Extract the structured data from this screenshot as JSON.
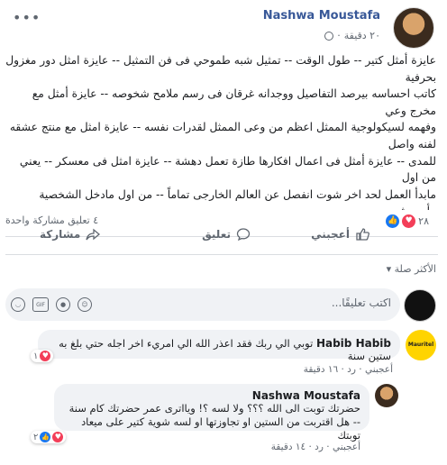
{
  "post": {
    "author": "Nashwa Moustafa",
    "time": "٢٠ دقيقة",
    "body": "عايزة أمثل كتير -- طول الوقت -- تمثيل شبه طموحي فى فن التمثيل -- عايزة امثل دور مغزول بحرفية\nكاتب احساسه بيرصد التفاصيل ووجدانه غرقان فى رسم ملامح شخوصه -- عايزة أمثل مع مخرج وعي\nوفهمه لسيكولوجية الممثل اعظم من وعى الممثل لقدرات نفسه -- عايزة امثل مع منتج عشقه لفنه واصل\nللمدى -- عايزة أمثل فى اعمال افكارها طازة تعمل دهشة -- عايزة امثل فى معسكر -- يعني من اول\nمابدأ العمل لحد اخر شوت انفصل عن العالم الخارجى تماماً -- من اول مادخل الشخصية مأرجعش\nنشوى غير مع كلمة فركش للعمل -- عايزة امثل مع كل المجانين المندوهين بنداهة الفن -- يارب حقق\nلى حلمى"
  },
  "stats": {
    "reactions": "٢٨",
    "counts": "٤ تعليق  مشاركة واحدة"
  },
  "actions": {
    "like": "أعجبني",
    "comment": "تعليق",
    "share": "مشاركة"
  },
  "sort_label": "الأكثر صلة ▾",
  "composer": {
    "placeholder": "اكتب تعليقًا..."
  },
  "comments": [
    {
      "author": "Habib Habib",
      "avatar_text": "Mauritel",
      "text": "توبي الي ربك فقد اعذر الله الي امريء اخر اجله حتي بلغ به ستين سنة",
      "like_label": "أعجبني",
      "reply_label": "رد",
      "time": "١٦ دقيقة",
      "reactions": "١"
    },
    {
      "author": "Nashwa Moustafa",
      "text": "حضرتك توبت الى الله ؟؟؟ ولا لسه ؟! ويااترى عمر حضرتك كام سنة -- هل اقتربت من الستين او تجاوزتها او لسه شوية كتير على ميعاد توبتك",
      "like_label": "أعجبني",
      "reply_label": "رد",
      "time": "١٤ دقيقة",
      "reactions": "٢"
    }
  ]
}
